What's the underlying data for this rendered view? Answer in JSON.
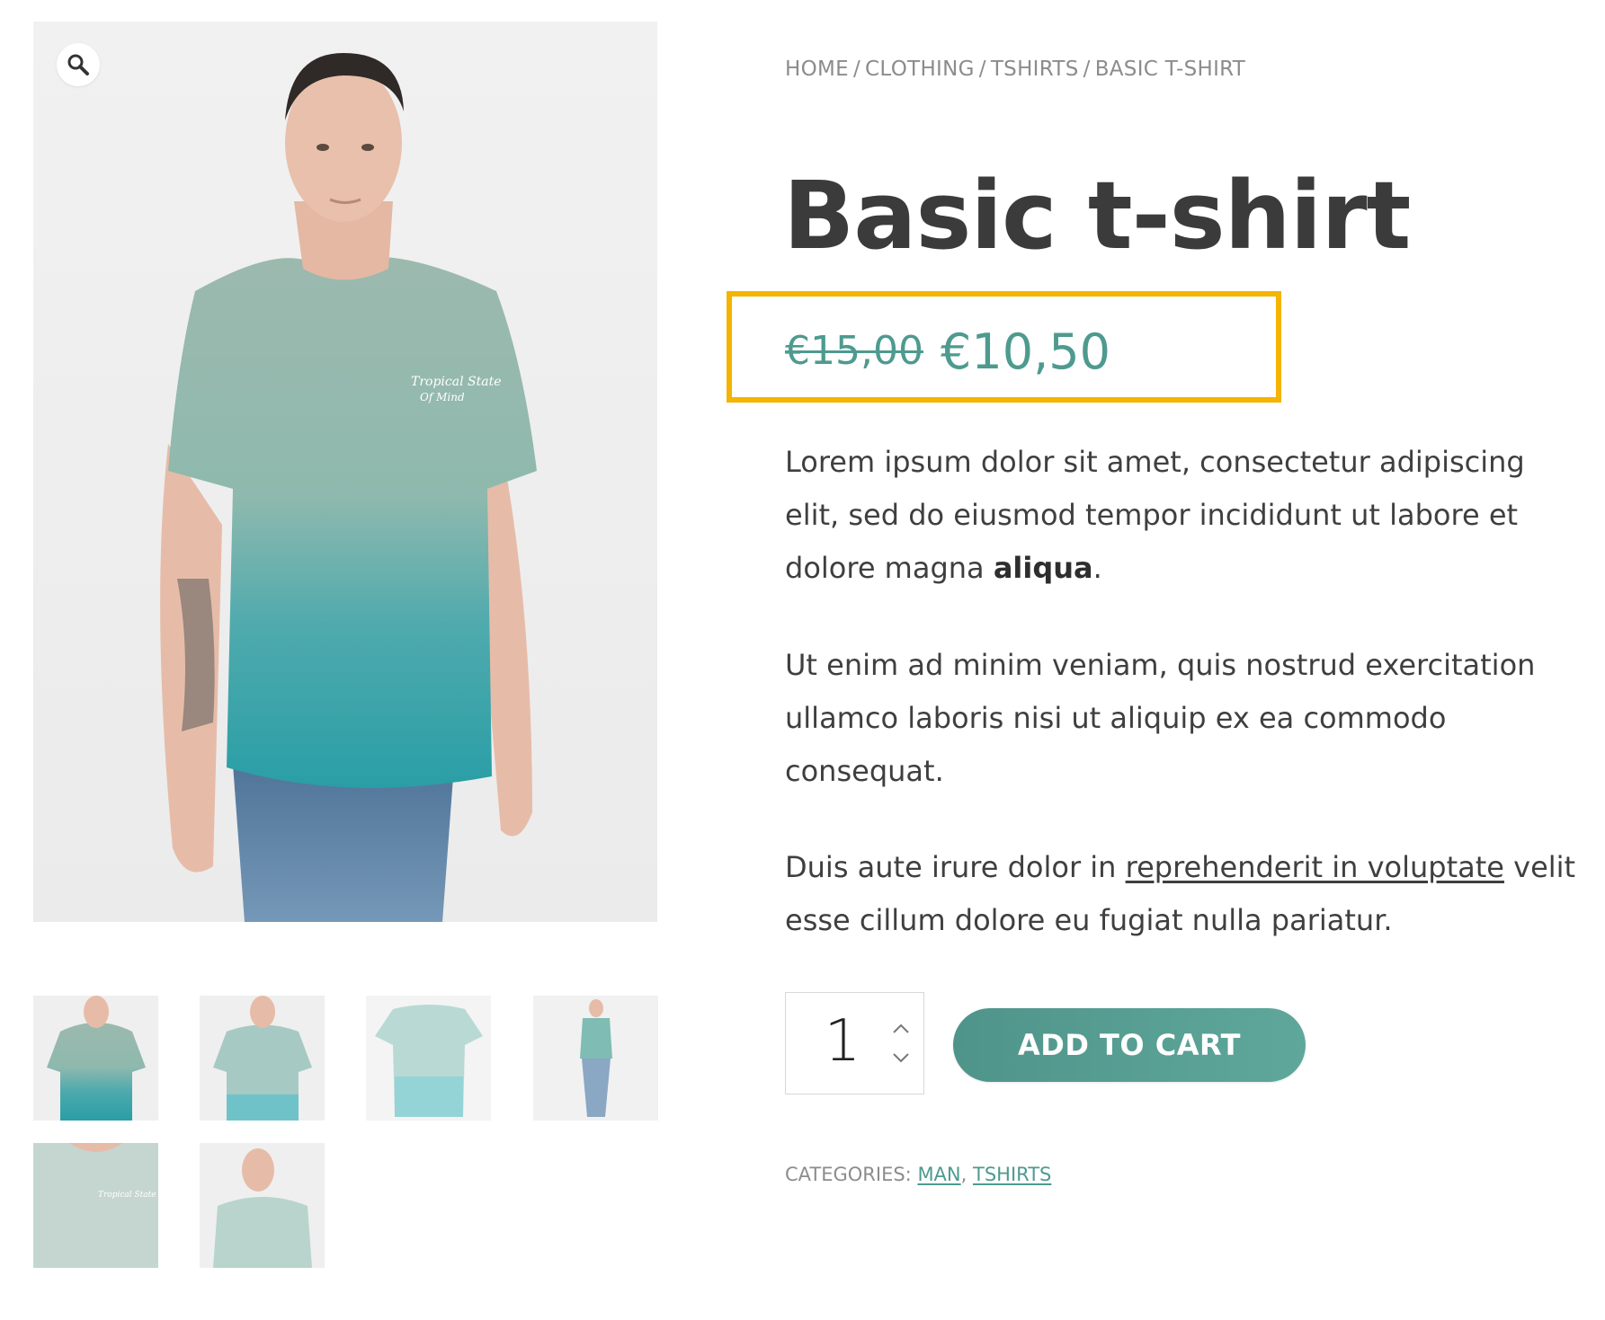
{
  "breadcrumb": {
    "items": [
      "HOME",
      "CLOTHING",
      "TSHIRTS",
      "BASIC T-SHIRT"
    ],
    "separator": "/"
  },
  "product": {
    "title": "Basic t-shirt",
    "price_old": "€15,00",
    "price_new": "€10,50",
    "description": {
      "p1_text": "Lorem ipsum dolor sit amet, consectetur adipiscing elit, sed do eiusmod tempor incididunt ut labore et dolore magna ",
      "p1_bold": "aliqua",
      "p1_end": ".",
      "p2": "Ut enim ad minim veniam, quis nostrud exercitation ullamco laboris nisi ut aliquip ex ea commodo consequat.",
      "p3_start": "Duis aute irure dolor in ",
      "p3_link": "reprehenderit in voluptate",
      "p3_end": " velit esse cillum dolore eu fugiat nulla pariatur."
    }
  },
  "cart": {
    "quantity": "1",
    "add_label": "ADD TO CART"
  },
  "meta": {
    "categories_label": "CATEGORIES: ",
    "categories": [
      "MAN",
      "TSHIRTS"
    ],
    "categories_sep": ", "
  },
  "colors": {
    "accent": "#4e9a8f",
    "highlight": "#f4b400",
    "title": "#3b3b3b",
    "shirt_top": "#9fbdb2",
    "shirt_bottom": "#2fa7ad"
  },
  "icons": {
    "zoom": "magnifier-icon",
    "up": "chevron-up-icon",
    "down": "chevron-down-icon"
  }
}
